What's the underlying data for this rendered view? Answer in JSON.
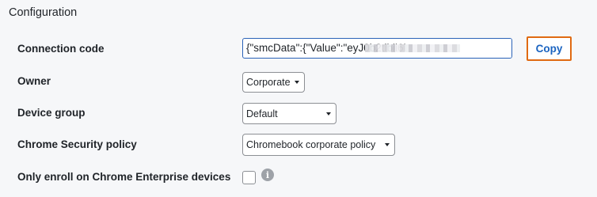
{
  "section": {
    "title": "Configuration"
  },
  "connection_code": {
    "label": "Connection code",
    "value": "{\"smcData\":{\"Value\":\"eyJ0b2tlbil6l",
    "copy_label": "Copy"
  },
  "owner": {
    "label": "Owner",
    "selected": "Corporate"
  },
  "device_group": {
    "label": "Device group",
    "selected": "Default"
  },
  "chrome_policy": {
    "label": "Chrome Security policy",
    "selected": "Chromebook corporate policy"
  },
  "enroll": {
    "label": "Only enroll on Chrome Enterprise devices",
    "checked": false
  },
  "colors": {
    "accent_outline": "#e06a12",
    "link_blue": "#1a63c0",
    "focus_border": "#2a62b8"
  }
}
